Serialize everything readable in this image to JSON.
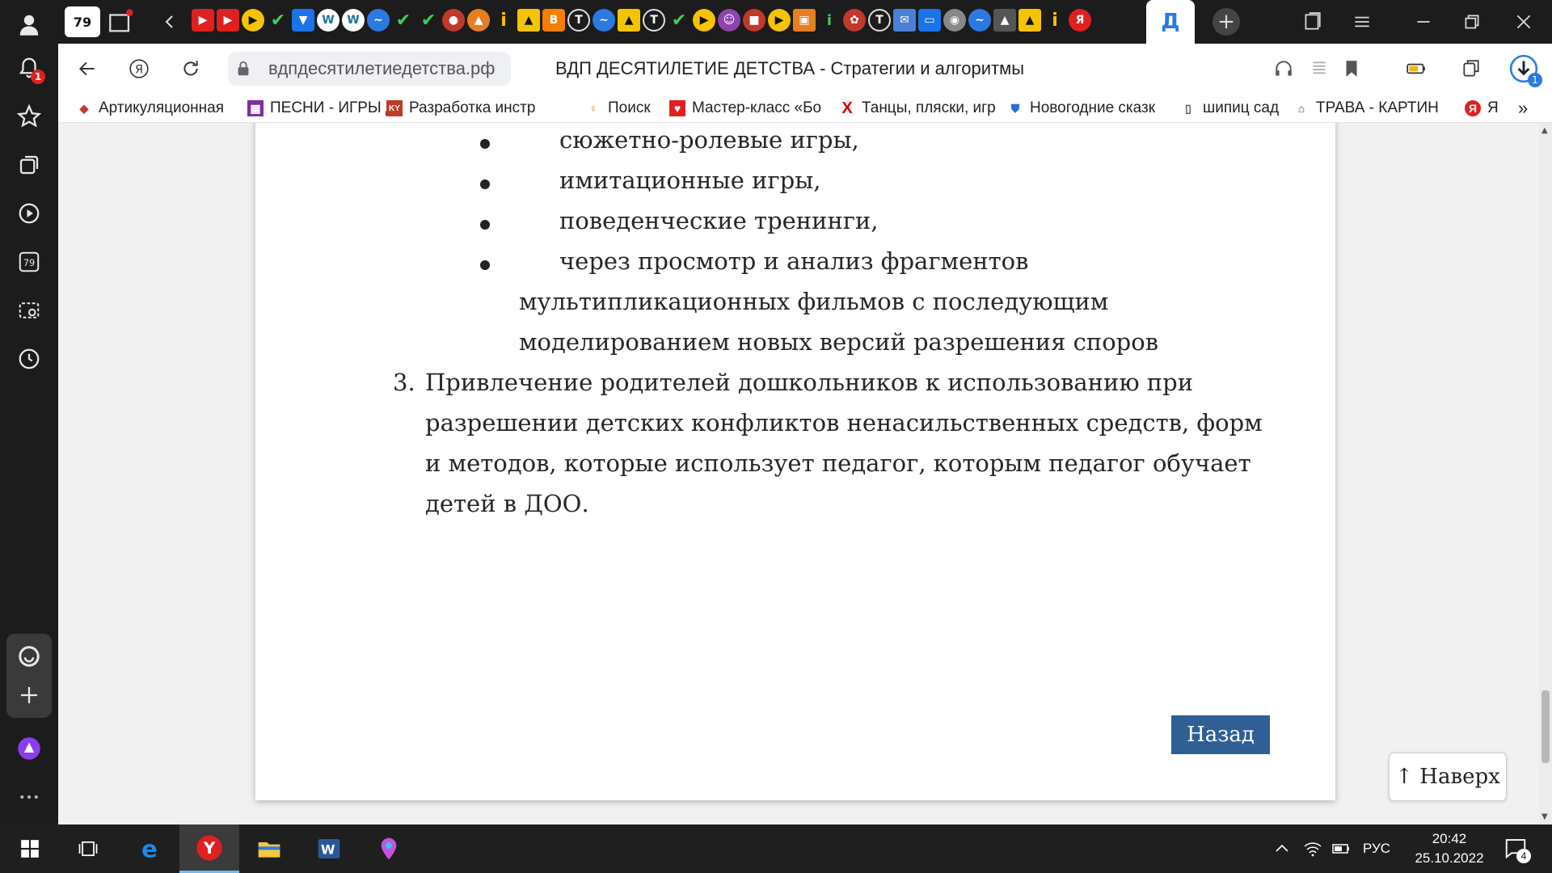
{
  "browser": {
    "tab_count": "79",
    "active_tab_glyph": "Д",
    "url": "вдпдесятилетиедетства.рф",
    "title": "ВДП ДЕСЯТИЛЕТИЕ ДЕТСТВА - Стратегии и алгоритмы",
    "notification_count": "1",
    "downloads_count": "1"
  },
  "bookmarks": [
    {
      "label": "Артикуляционная",
      "icon": "puzzle-icon",
      "color": "#c0392b"
    },
    {
      "label": "ПЕСНИ - ИГРЫ Д/",
      "icon": "grid-icon",
      "color": "#7b2fa0"
    },
    {
      "label": "Разработка инстр",
      "icon": "logo-icon",
      "color": "#c0392b"
    },
    {
      "label": "Поиск",
      "icon": "girl-icon",
      "color": "#e67e22"
    },
    {
      "label": "Мастер-класс «Бо",
      "icon": "heart-icon",
      "color": "#e02020"
    },
    {
      "label": "Танцы, пляски, игр",
      "icon": "x-icon",
      "color": "#d00000"
    },
    {
      "label": "Новогодние сказк",
      "icon": "shield-icon",
      "color": "#2a6fd6"
    },
    {
      "label": "шипиц сад",
      "icon": "doc-icon",
      "color": "#555555"
    },
    {
      "label": "ТРАВА - КАРТИНК",
      "icon": "house-icon",
      "color": "#6b3b1e"
    },
    {
      "label": "Я",
      "icon": "yandex-icon",
      "color": "#e02020"
    }
  ],
  "document": {
    "bullets": [
      "сюжетно-ролевые игры,",
      "имитационные игры,",
      "поведенческие тренинги,",
      "через просмотр и анализ фрагментов"
    ],
    "bullet_continuation": [
      "мультипликационных фильмов с последующим",
      "моделированием новых версий разрешения споров"
    ],
    "item_number": "3.",
    "item_lines": [
      "Привлечение родителей дошкольников к использованию при",
      "разрешении детских конфликтов ненасильственных средств, форм",
      "и методов, которые использует педагог, которым педагог обучает",
      "детей в ДОО."
    ],
    "back_button": "Назад",
    "top_button": "↑ Наверх"
  },
  "taskbar": {
    "language": "РУС",
    "time": "20:42",
    "date": "25.10.2022",
    "notifications": "4"
  },
  "colors": {
    "back_button": "#2f5f95",
    "sidebar": "#1c1c1c",
    "badge": "#e02020"
  }
}
